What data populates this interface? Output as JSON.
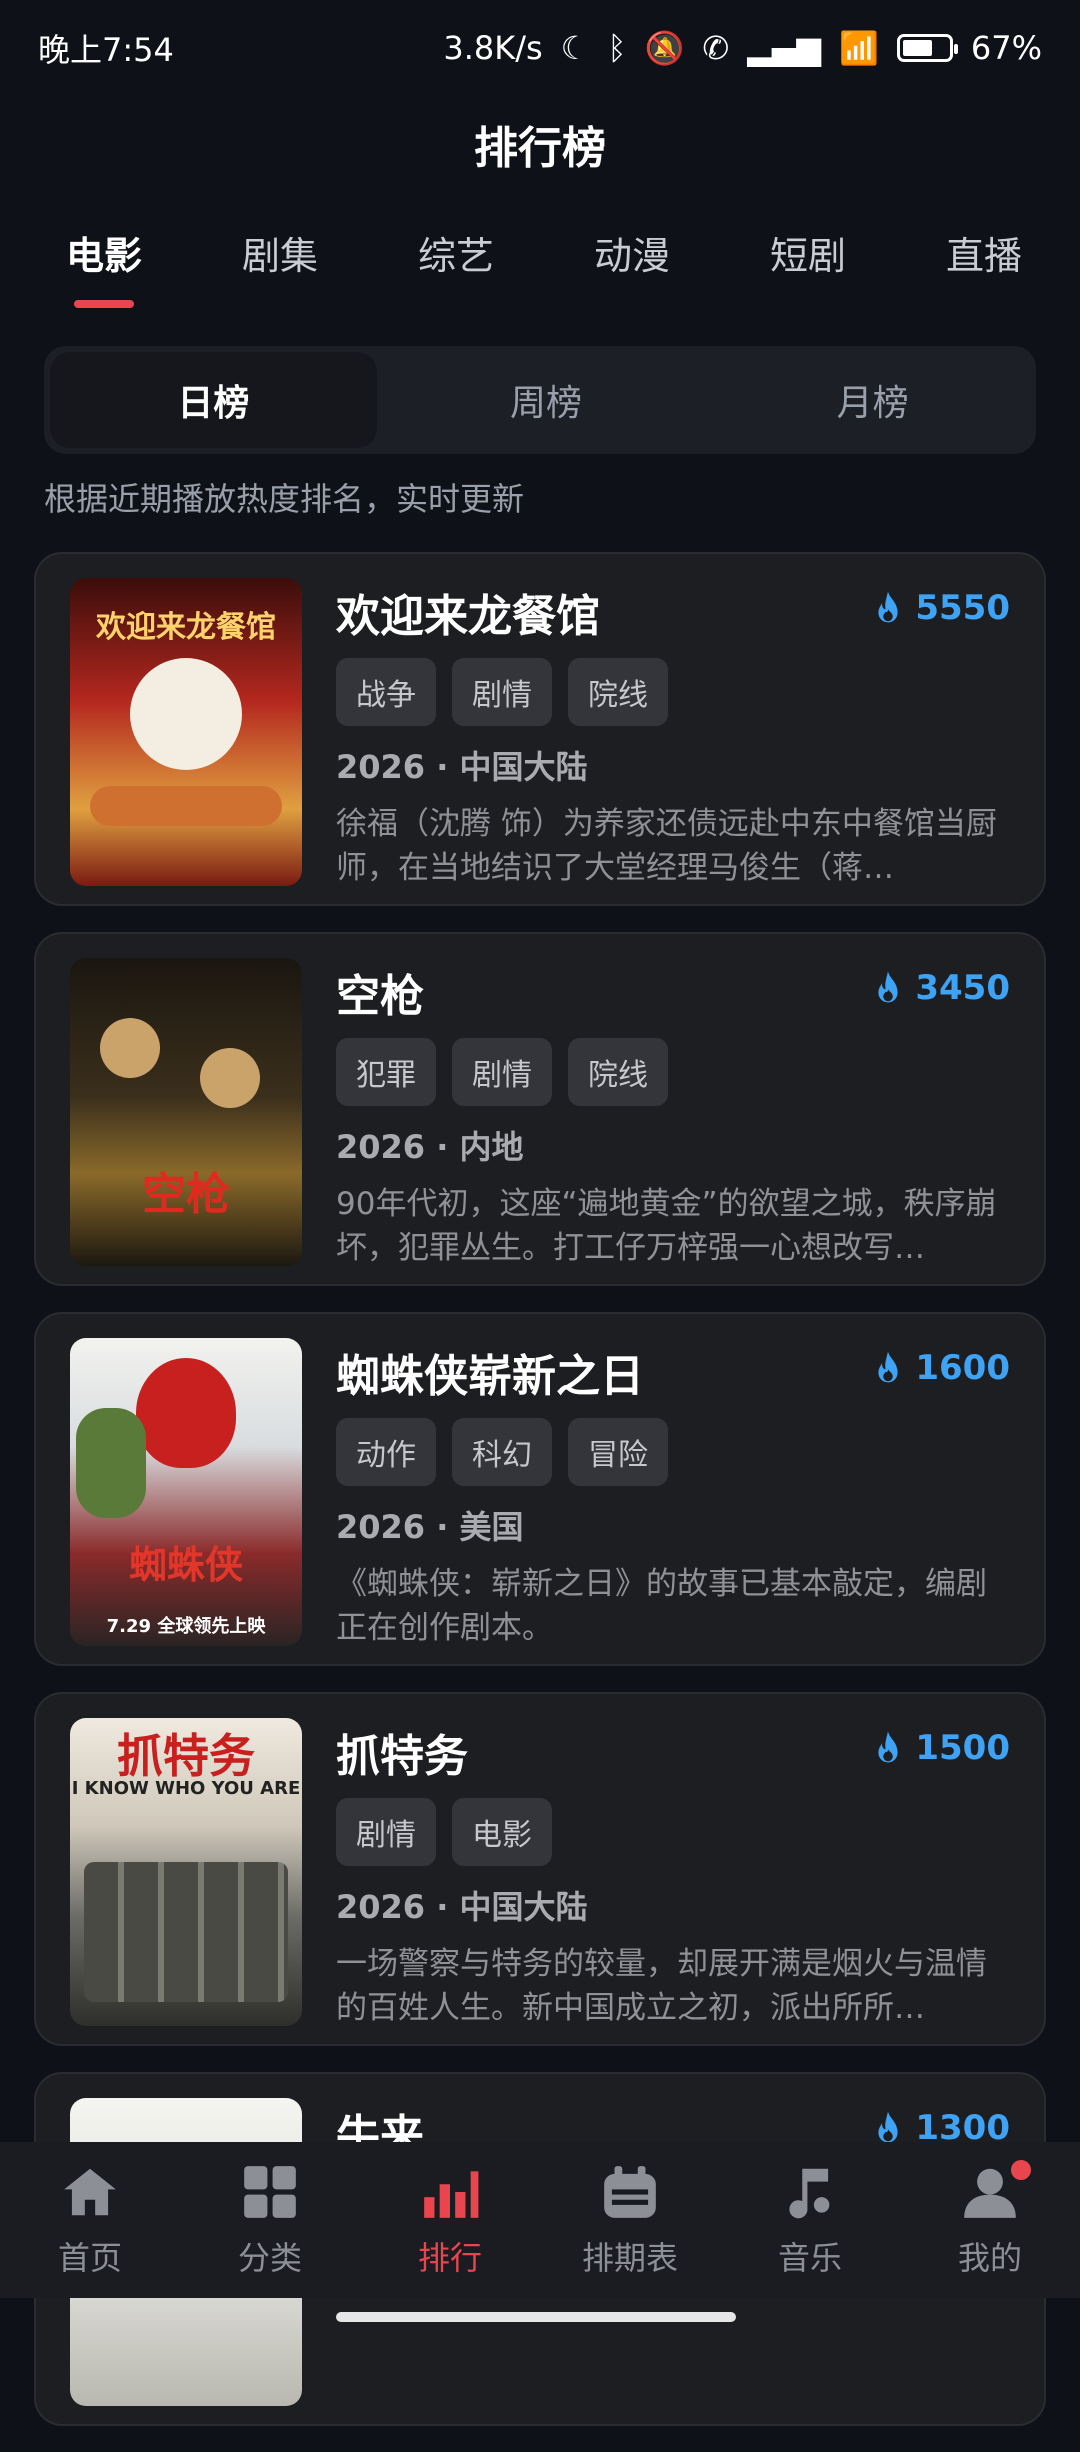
{
  "status": {
    "time": "晚上7:54",
    "speed": "3.8K/s",
    "battery_percent": "67%",
    "battery_level": 0.67
  },
  "header": {
    "title": "排行榜"
  },
  "tabs": [
    {
      "label": "电影",
      "active": true
    },
    {
      "label": "剧集"
    },
    {
      "label": "综艺"
    },
    {
      "label": "动漫"
    },
    {
      "label": "短剧"
    },
    {
      "label": "直播"
    }
  ],
  "segments": [
    {
      "label": "日榜",
      "active": true
    },
    {
      "label": "周榜"
    },
    {
      "label": "月榜"
    }
  ],
  "hint": "根据近期播放热度排名，实时更新",
  "movies": [
    {
      "title": "欢迎来龙餐馆",
      "heat": "5550",
      "tags": [
        "战争",
        "剧情",
        "院线"
      ],
      "meta": "2026 · 中国大陆",
      "desc": "徐福（沈腾 饰）为养家还债远赴中东中餐馆当厨师，在当地结识了大堂经理马俊生（蒋…",
      "poster_text": "欢迎来龙餐馆",
      "poster_bg": "#b4281f"
    },
    {
      "title": "空枪",
      "heat": "3450",
      "tags": [
        "犯罪",
        "剧情",
        "院线"
      ],
      "meta": "2026 · 内地",
      "desc": "90年代初，这座“遍地黄金”的欲望之城，秩序崩坏，犯罪丛生。打工仔万梓强一心想改写…",
      "poster_text": "空枪",
      "poster_bg": "#3b2f1c"
    },
    {
      "title": "蜘蛛侠崭新之日",
      "heat": "1600",
      "tags": [
        "动作",
        "科幻",
        "冒险"
      ],
      "meta": "2026 · 美国",
      "desc": "《蜘蛛侠：崭新之日》的故事已基本敲定，编剧正在创作剧本。",
      "poster_text": "蜘蛛侠",
      "poster_sub": "7.29 全球领先上映",
      "poster_bg": "#d9dde0"
    },
    {
      "title": "抓特务",
      "heat": "1500",
      "tags": [
        "剧情",
        "电影"
      ],
      "meta": "2026 · 中国大陆",
      "desc": "一场警察与特务的较量，却展开满是烟火与温情的百姓人生。新中国成立之初，派出所所…",
      "poster_text": "抓特务",
      "poster_sub": "I KNOW WHO YOU ARE",
      "poster_bg": "#6a6a66"
    },
    {
      "title": "牛来",
      "heat": "1300",
      "tags": [],
      "meta": "",
      "desc": "",
      "poster_text": "",
      "poster_bg": "#e8e8e4"
    }
  ],
  "nav": [
    {
      "label": "首页",
      "icon": "home-icon"
    },
    {
      "label": "分类",
      "icon": "grid-icon"
    },
    {
      "label": "排行",
      "icon": "bar-chart-icon",
      "active": true
    },
    {
      "label": "排期表",
      "icon": "calendar-icon"
    },
    {
      "label": "音乐",
      "icon": "music-note-icon"
    },
    {
      "label": "我的",
      "icon": "user-icon"
    }
  ]
}
